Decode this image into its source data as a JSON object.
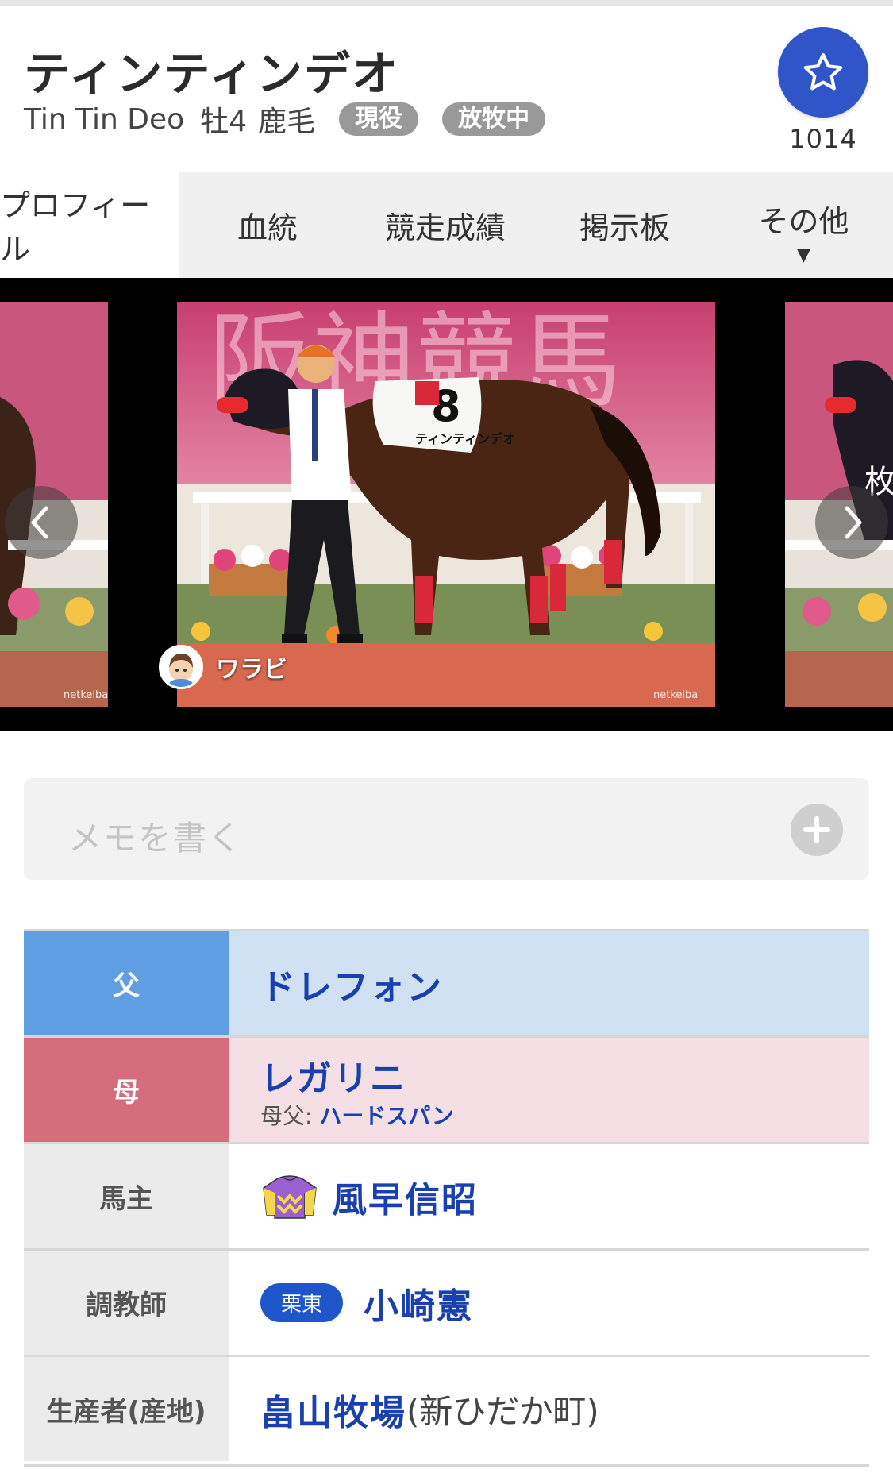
{
  "horse": {
    "name": "ティンティンデオ",
    "name_en": "Tin Tin Deo",
    "sex_age": "牡4",
    "coat": "鹿毛",
    "badges": [
      "現役",
      "放牧中"
    ]
  },
  "favorite": {
    "icon": "star-icon",
    "count": "1014",
    "color": "#2f55c8"
  },
  "tabs": [
    {
      "label": "プロフィール",
      "active": true
    },
    {
      "label": "血統"
    },
    {
      "label": "競走成績"
    },
    {
      "label": "掲示板"
    },
    {
      "label": "その他",
      "dropdown_arrow": "▼"
    }
  ],
  "gallery": {
    "poster_name": "ワラビ",
    "watermark": "netkeiba",
    "saddle_number": "8",
    "saddle_name": "ティンティンデオ",
    "banner_text": "阪神競馬",
    "next_peek_text": "枚"
  },
  "memo": {
    "placeholder": "メモを書く",
    "add_icon": "plus-circle-icon"
  },
  "info": {
    "sire": {
      "label": "父",
      "value": "ドレフォン"
    },
    "dam": {
      "label": "母",
      "value": "レガリニ",
      "damsire_label": "母父:",
      "damsire_value": "ハードスパン"
    },
    "owner": {
      "label": "馬主",
      "value": "風早信昭"
    },
    "trainer": {
      "label": "調教師",
      "region": "栗東",
      "value": "小崎憲"
    },
    "breeder": {
      "label": "生産者(産地)",
      "value": "畠山牧場",
      "origin": "(新ひだか町)"
    }
  },
  "colors": {
    "sire_label": "#5f9ee2",
    "sire_bg": "#cfe1f3",
    "dam_label": "#d66d7d",
    "dam_bg": "#f4dfe4",
    "link": "#1a3fae"
  }
}
